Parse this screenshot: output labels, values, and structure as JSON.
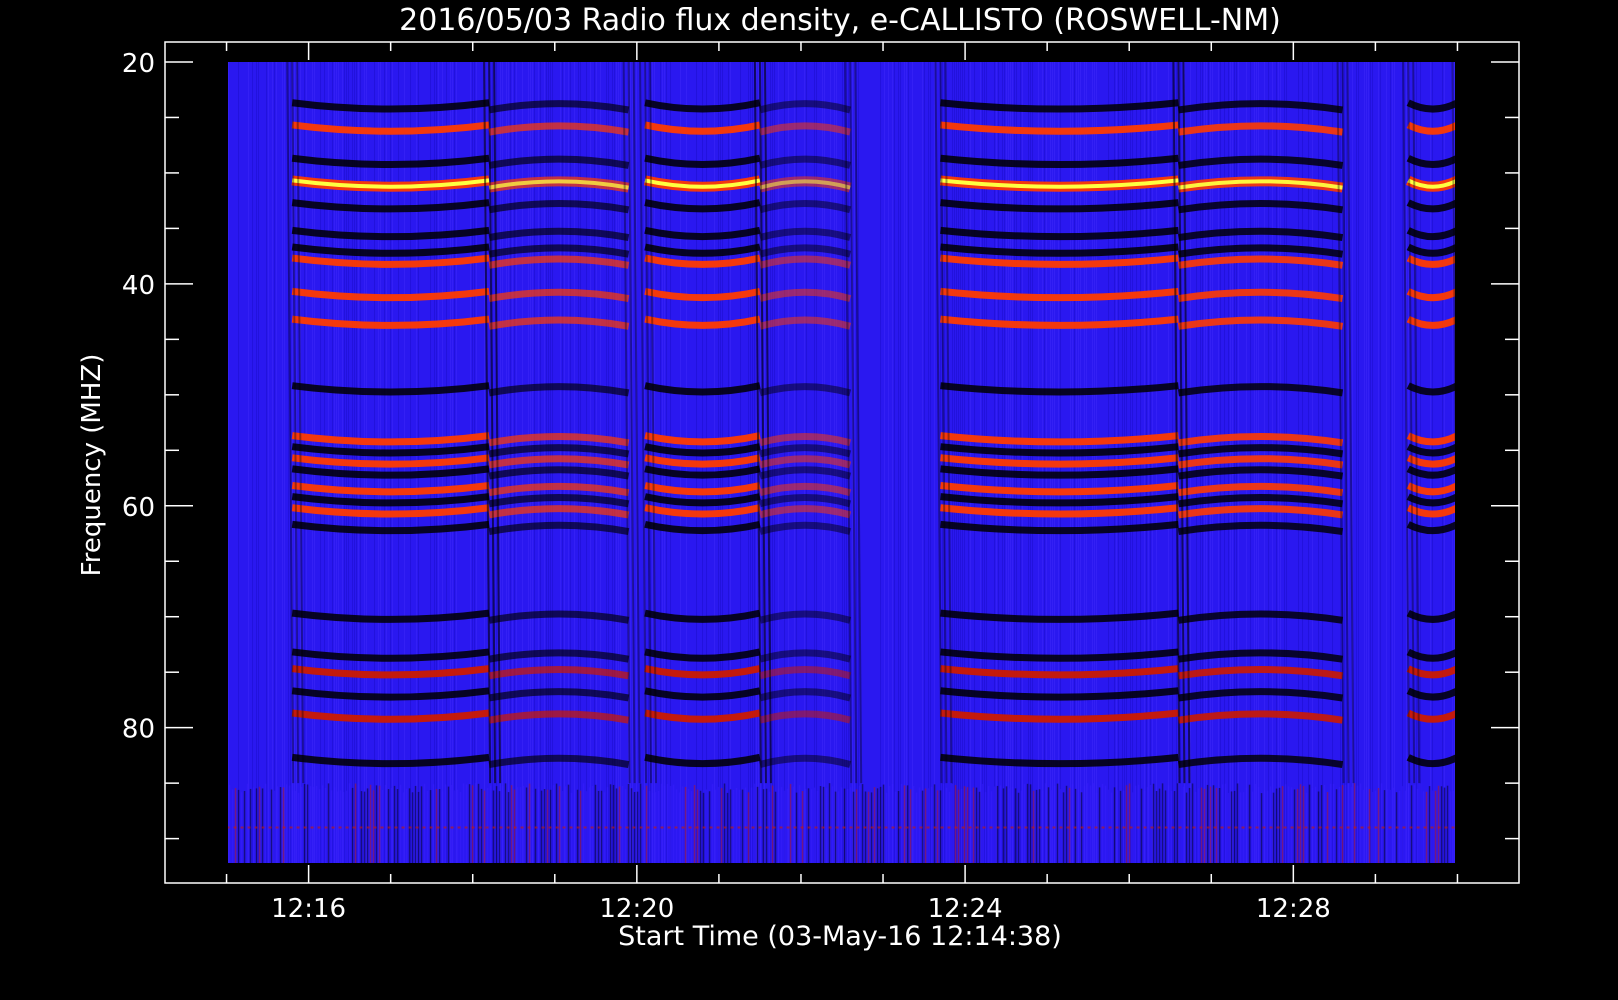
{
  "chart_data": {
    "type": "heatmap",
    "title": "2016/05/03  Radio flux density, e-CALLISTO (ROSWELL-NM)",
    "xlabel": "Start Time (03-May-16 12:14:38)",
    "ylabel": "Frequency (MHZ)",
    "x_ticks": [
      "12:16",
      "12:20",
      "12:24",
      "12:28"
    ],
    "x_tick_minutes": [
      16,
      20,
      24,
      28
    ],
    "x_range_minutes": [
      14.25,
      30.75
    ],
    "data_x_range_minutes": [
      15.0,
      30.0
    ],
    "y_ticks": [
      "20",
      "40",
      "60",
      "80"
    ],
    "y_tick_values": [
      20,
      40,
      60,
      80
    ],
    "y_minor_step": 5,
    "ylim": [
      18.2,
      94
    ],
    "data_y_range": [
      20,
      92.4
    ],
    "colormap": [
      "#000000",
      "#1c10e8",
      "#3a1fff",
      "#cc1a00",
      "#ff3a00",
      "#ffff40"
    ],
    "background_color": "#2a18f0",
    "bright_bands_mhz": [
      26,
      31,
      38,
      41,
      43.5,
      54,
      56,
      58.5,
      60.5,
      75,
      79
    ],
    "dark_bands_mhz": [
      24,
      29,
      33,
      35.5,
      37,
      49.5,
      55,
      57,
      59.5,
      62,
      70,
      73.5,
      77,
      83
    ],
    "strongest_band_mhz": 31,
    "activity_segments_minutes": [
      {
        "start": 15.8,
        "end": 18.2,
        "level": 1.0
      },
      {
        "start": 18.2,
        "end": 19.9,
        "level": 0.75
      },
      {
        "start": 20.1,
        "end": 21.5,
        "level": 1.0
      },
      {
        "start": 21.5,
        "end": 22.6,
        "level": 0.55
      },
      {
        "start": 23.7,
        "end": 26.6,
        "level": 1.0
      },
      {
        "start": 26.6,
        "end": 28.6,
        "level": 0.95
      },
      {
        "start": 29.4,
        "end": 30.0,
        "level": 1.0
      }
    ],
    "quiet_intervals_minutes": [
      [
        15.0,
        15.8
      ],
      [
        22.6,
        23.7
      ],
      [
        28.6,
        29.4
      ]
    ],
    "noisy_band_mhz": [
      85,
      92.4
    ],
    "grid": false,
    "legend": "none"
  }
}
